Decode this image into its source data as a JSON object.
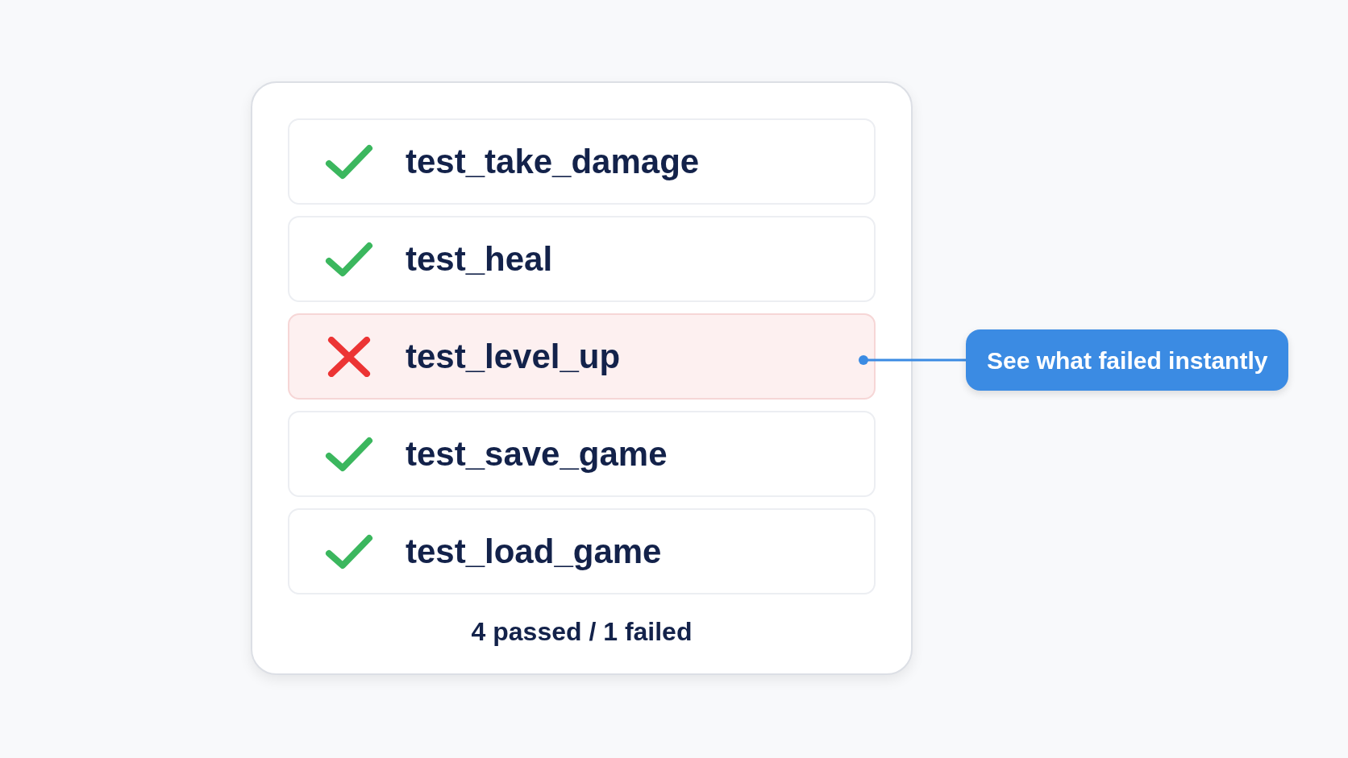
{
  "tests": [
    {
      "name": "test_take_damage",
      "kind": "passed"
    },
    {
      "name": "test_heal",
      "kind": "passed"
    },
    {
      "name": "test_level_up",
      "kind": "failed"
    },
    {
      "name": "test_save_game",
      "kind": "passed"
    },
    {
      "name": "test_load_game",
      "kind": "passed"
    }
  ],
  "summary": "4 passed / 1 failed",
  "callout": {
    "text": "See what failed instantly"
  }
}
